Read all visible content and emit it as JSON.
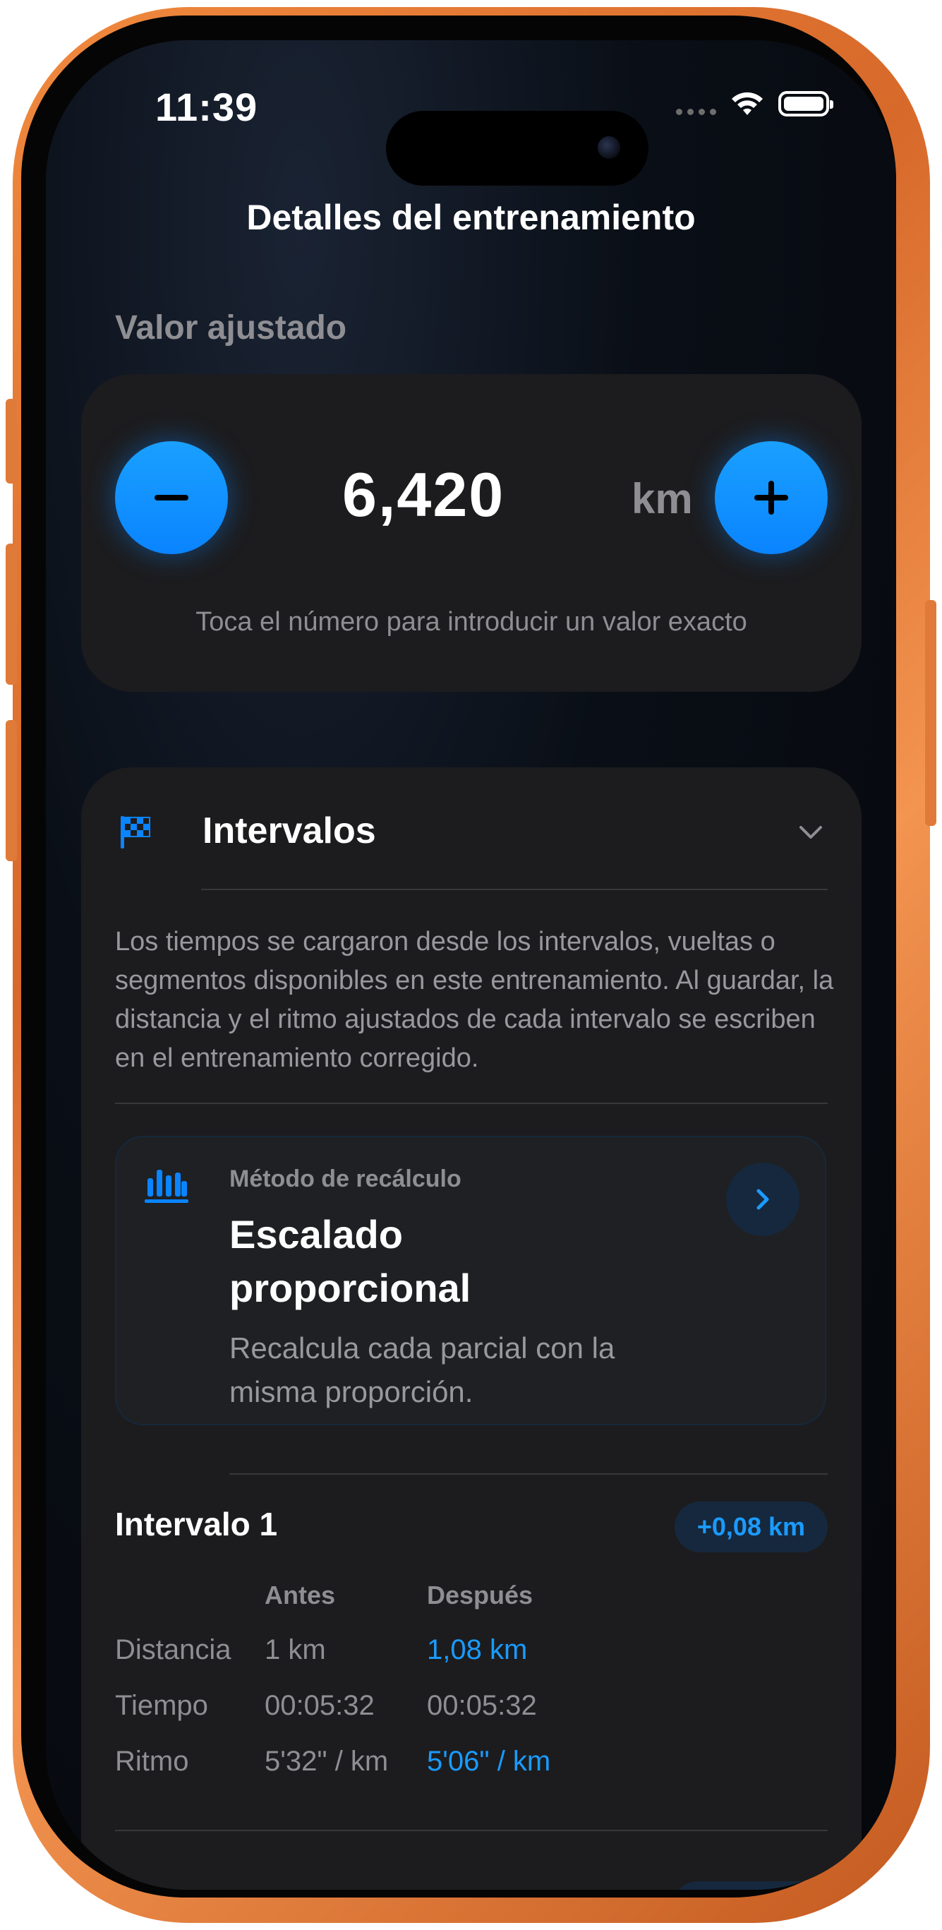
{
  "status": {
    "time": "11:39"
  },
  "nav": {
    "title": "Detalles del entrenamiento"
  },
  "adjust": {
    "section_label": "Valor ajustado",
    "value": "6,420",
    "unit": "km",
    "hint": "Toca el número para introducir un valor exacto"
  },
  "intervals": {
    "title": "Intervalos",
    "description": "Los tiempos se cargaron desde los intervalos, vueltas o segmentos disponibles en este entrenamiento. Al guardar, la distancia y el ritmo ajustados de cada intervalo se escriben en el entrenamiento corregido.",
    "method": {
      "label": "Método de recálculo",
      "title": "Escalado proporcional",
      "description": "Recalcula cada parcial con la misma proporción."
    },
    "items": [
      {
        "title": "Intervalo 1",
        "delta": "+0,08 km",
        "headers": {
          "before": "Antes",
          "after": "Después"
        },
        "rows": [
          {
            "label": "Distancia",
            "before": "1 km",
            "after": "1,08 km"
          },
          {
            "label": "Tiempo",
            "before": "00:05:32",
            "after": "00:05:32"
          },
          {
            "label": "Ritmo",
            "before": "5'32\" / km",
            "after": "5'06\" / km"
          }
        ]
      }
    ]
  },
  "colors": {
    "accent": "#0a84ff",
    "frame": "#e07a38",
    "card": "#1c1c1e"
  }
}
